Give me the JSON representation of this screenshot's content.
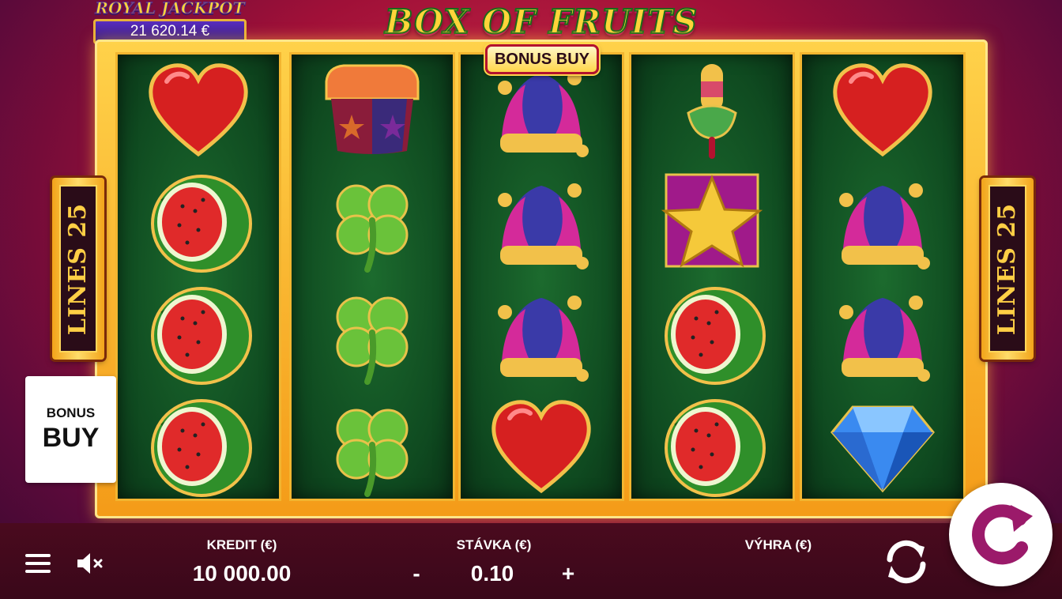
{
  "game": {
    "title": "BOX OF FRUITS",
    "title_badge": "BONUS BUY"
  },
  "jackpot": {
    "title": "ROYAL JACKPOT",
    "value": "21 620.14 €"
  },
  "lines": {
    "left_label": "LINES 25",
    "right_label": "LINES 25"
  },
  "side_bonus": {
    "line1": "BONUS",
    "line2": "BUY"
  },
  "reels": [
    [
      "heart",
      "watermelon",
      "watermelon",
      "watermelon"
    ],
    [
      "mystery-box",
      "clover",
      "clover",
      "clover"
    ],
    [
      "jester-hat",
      "jester-hat",
      "jester-hat",
      "heart"
    ],
    [
      "popsicle",
      "star",
      "watermelon",
      "watermelon"
    ],
    [
      "heart",
      "jester-hat",
      "jester-hat",
      "diamond"
    ]
  ],
  "bottom_bar": {
    "credit_label": "KREDIT (€)",
    "credit_value": "10 000.00",
    "bet_label": "STÁVKA (€)",
    "bet_value": "0.10",
    "bet_minus": "-",
    "bet_plus": "+",
    "win_label": "VÝHRA (€)",
    "win_value": ""
  },
  "icons": {
    "menu": "menu-icon",
    "sound": "sound-muted-icon",
    "autoplay": "autoplay-icon",
    "spin": "spin-icon"
  },
  "colors": {
    "background": "#a01038",
    "reel_bg": "#0f4a20",
    "frame_gold": "#f2b530",
    "jackpot_bg": "#3a18a0"
  }
}
